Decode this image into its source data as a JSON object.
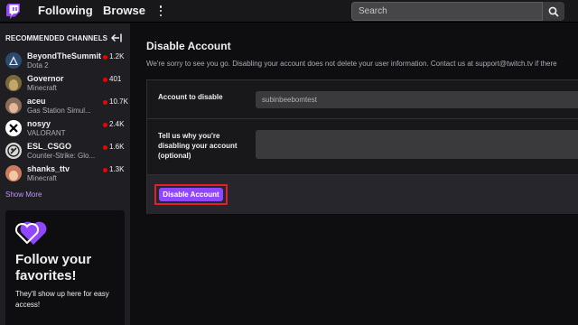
{
  "nav": {
    "following": "Following",
    "browse": "Browse",
    "search_placeholder": "Search"
  },
  "sidebar": {
    "header": "RECOMMENDED CHANNELS",
    "channels": [
      {
        "name": "BeyondTheSummit",
        "game": "Dota 2",
        "viewers": "1.2K",
        "avatar_color": "#2c4a6e"
      },
      {
        "name": "Governor",
        "game": "Minecraft",
        "viewers": "401",
        "avatar_color": "#7a6a3a"
      },
      {
        "name": "aceu",
        "game": "Gas Station Simul...",
        "viewers": "10.7K",
        "avatar_color": "#8a6d5a"
      },
      {
        "name": "nosyy",
        "game": "VALORANT",
        "viewers": "2.4K",
        "avatar_color": "#ffffff"
      },
      {
        "name": "ESL_CSGO",
        "game": "Counter-Strike: Glo...",
        "viewers": "1.6K",
        "avatar_color": "#d9d9d9"
      },
      {
        "name": "shanks_ttv",
        "game": "Minecraft",
        "viewers": "1.3K",
        "avatar_color": "#c97c5d"
      }
    ],
    "show_more": "Show More",
    "promo": {
      "title": "Follow your favorites!",
      "text": "They'll show up here for easy access!"
    }
  },
  "main": {
    "title": "Disable Account",
    "description": "We're sorry to see you go. Disabling your account does not delete your user information. Contact us at support@twitch.tv if there",
    "account_label": "Account to disable",
    "account_value": "subinbeebomtest",
    "reason_label": "Tell us why you're disabling your account (optional)",
    "reason_value": "",
    "button": "Disable Account"
  },
  "colors": {
    "accent": "#9147ff",
    "live": "#eb0400",
    "highlight": "#e0212b"
  }
}
